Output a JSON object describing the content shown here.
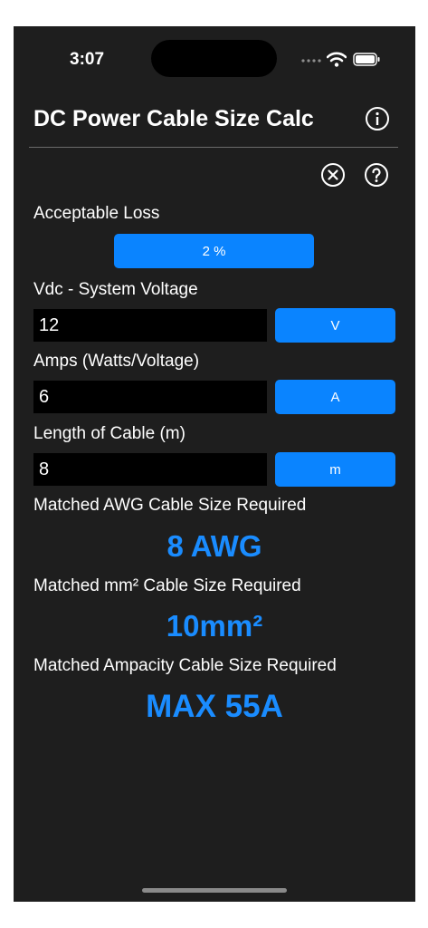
{
  "status_bar": {
    "time": "3:07"
  },
  "header": {
    "title": "DC Power Cable Size Calc"
  },
  "acceptable_loss": {
    "label": "Acceptable Loss",
    "value": "2 %"
  },
  "voltage": {
    "label": "Vdc - System Voltage",
    "value": "12",
    "unit": "V"
  },
  "amps": {
    "label": "Amps (Watts/Voltage)",
    "value": "6",
    "unit": "A"
  },
  "length": {
    "label": "Length of Cable (m)",
    "value": "8",
    "unit": "m"
  },
  "results": {
    "awg_label": "Matched AWG Cable Size Required",
    "awg_value": "8 AWG",
    "mm2_label": "Matched mm² Cable Size Required",
    "mm2_value": "10mm²",
    "ampacity_label": "Matched Ampacity Cable Size Required",
    "ampacity_value": "MAX 55A"
  },
  "colors": {
    "accent": "#0a84ff",
    "result": "#1a8cff",
    "background": "#1e1e1e"
  }
}
